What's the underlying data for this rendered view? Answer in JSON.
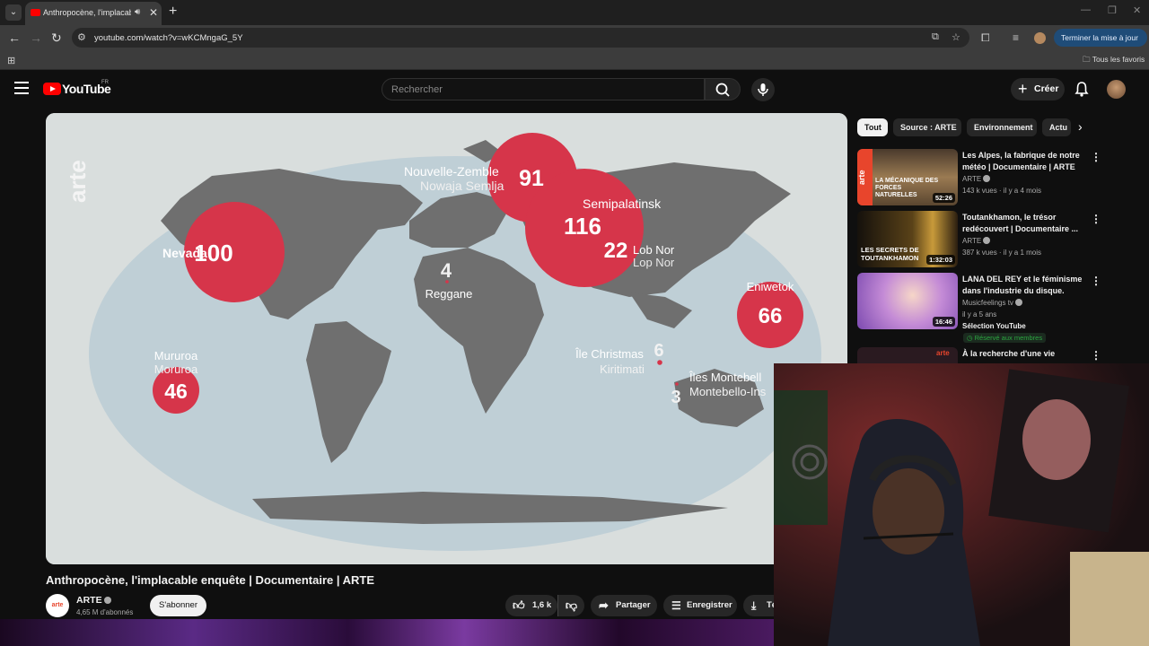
{
  "browser": {
    "tab_title": "Anthropocène, l'implacable",
    "url": "youtube.com/watch?v=wKCMngaG_5Y",
    "update_button": "Terminer la mise à jour",
    "bookmarks_all": "Tous les favoris"
  },
  "youtube": {
    "logo_text": "YouTube",
    "country_code": "FR",
    "search_placeholder": "Rechercher",
    "create_label": "Créer"
  },
  "video": {
    "title": "Anthropocène, l'implacable enquête | Documentaire | ARTE",
    "watermark": "arte",
    "map_sites": [
      {
        "name": "Nevada",
        "count": "100"
      },
      {
        "name": "Nouvelle-Zemble",
        "alt": "Nowaja Semlja",
        "count": "91"
      },
      {
        "name": "Semipalatinsk",
        "count": "116"
      },
      {
        "name": "Lob Nor",
        "alt": "Lop Nor",
        "count": "22"
      },
      {
        "name": "Reggane",
        "count": "4"
      },
      {
        "name": "Eniwetok",
        "count": "66"
      },
      {
        "name": "Mururoa",
        "alt": "Moruroa",
        "count": "46"
      },
      {
        "name": "Île Christmas",
        "alt": "Kiritimati",
        "count": "6"
      },
      {
        "name": "Îles Montebell",
        "alt": "Montebello-Ins",
        "count": "3"
      }
    ]
  },
  "channel": {
    "logo_text": "arte",
    "name": "ARTE",
    "subscribers": "4,65 M d'abonnés",
    "subscribe_label": "S'abonner"
  },
  "actions": {
    "likes": "1,6 k",
    "share": "Partager",
    "save": "Enregistrer",
    "download": "Té"
  },
  "sidebar": {
    "chips": [
      "Tout",
      "Source : ARTE",
      "Environnement",
      "Actu"
    ],
    "recommendations": [
      {
        "title": "Les Alpes, la fabrique de notre météo | Documentaire | ARTE",
        "channel": "ARTE",
        "meta": "143 k vues · il y a 4 mois",
        "duration": "52:26",
        "thumb_text": "LA MÉCANIQUE DES FORCES NATURELLES",
        "thumb_logo": "arte"
      },
      {
        "title": "Toutankhamon, le trésor redécouvert | Documentaire ...",
        "channel": "ARTE",
        "meta": "387 k vues · il y a 1 mois",
        "duration": "1:32:03",
        "thumb_text": "LES SECRETS DE TOUTANKHAMON"
      },
      {
        "title": "LANA DEL REY et le féminisme dans l'industrie du disque.",
        "channel": "Musicfeelings tv",
        "meta": "il y a 5 ans",
        "duration": "16:46",
        "extra": "Sélection YouTube",
        "badge": "Réservé aux membres"
      },
      {
        "title": "À la recherche d'une vie",
        "thumb_logo": "arte"
      }
    ]
  },
  "colors": {
    "accent_red": "#ff0000",
    "bubble_red": "#d6354a",
    "map_land": "#6f6f6f",
    "ocean": "#bfcfd6"
  }
}
